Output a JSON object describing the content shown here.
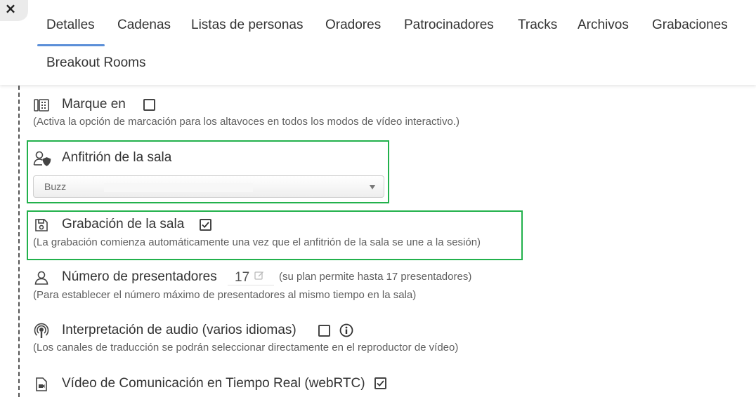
{
  "close": {
    "label": "×",
    "icon": "close-icon"
  },
  "tabs": [
    {
      "label": "Detalles",
      "active": true
    },
    {
      "label": "Cadenas"
    },
    {
      "label": "Listas de personas"
    },
    {
      "label": "Oradores"
    },
    {
      "label": "Patrocinadores"
    },
    {
      "label": "Tracks"
    },
    {
      "label": "Archivos"
    },
    {
      "label": "Grabaciones"
    },
    {
      "label": "Breakout Rooms"
    }
  ],
  "settings": {
    "dial_in": {
      "icon": "phone-keypad-icon",
      "title": "Marque en",
      "checked": false,
      "description": "(Activa la opción de marcación para los altavoces en todos los modos de vídeo interactivo.)"
    },
    "room_host": {
      "icon": "user-shield-icon",
      "title": "Anfitrión de la sala",
      "selected_value": "Buzz"
    },
    "room_recording": {
      "icon": "save-icon",
      "title": "Grabación de la sala",
      "checked": true,
      "description": "(La grabación comienza automáticamente una vez que el anfitrión de la sala se une a la sesión)"
    },
    "presenters": {
      "icon": "user-icon",
      "title": "Número de presentadores",
      "value": "17",
      "plan_note": "(su plan permite hasta 17 presentadores)",
      "description": "(Para establecer el número máximo de presentadores al mismo tiempo en la sala)"
    },
    "audio_interpretation": {
      "icon": "podcast-icon",
      "title": "Interpretación de audio (varios idiomas)",
      "checked": false,
      "info_icon": "info-icon",
      "description": "(Los canales de traducción se podrán seleccionar directamente en el reproductor de vídeo)"
    },
    "webrtc": {
      "icon": "video-file-icon",
      "title": "Vídeo de Comunicación en Tiempo Real (webRTC)",
      "checked": true
    }
  },
  "colors": {
    "accent": "#5b8fd8",
    "highlight": "#22b14c"
  }
}
